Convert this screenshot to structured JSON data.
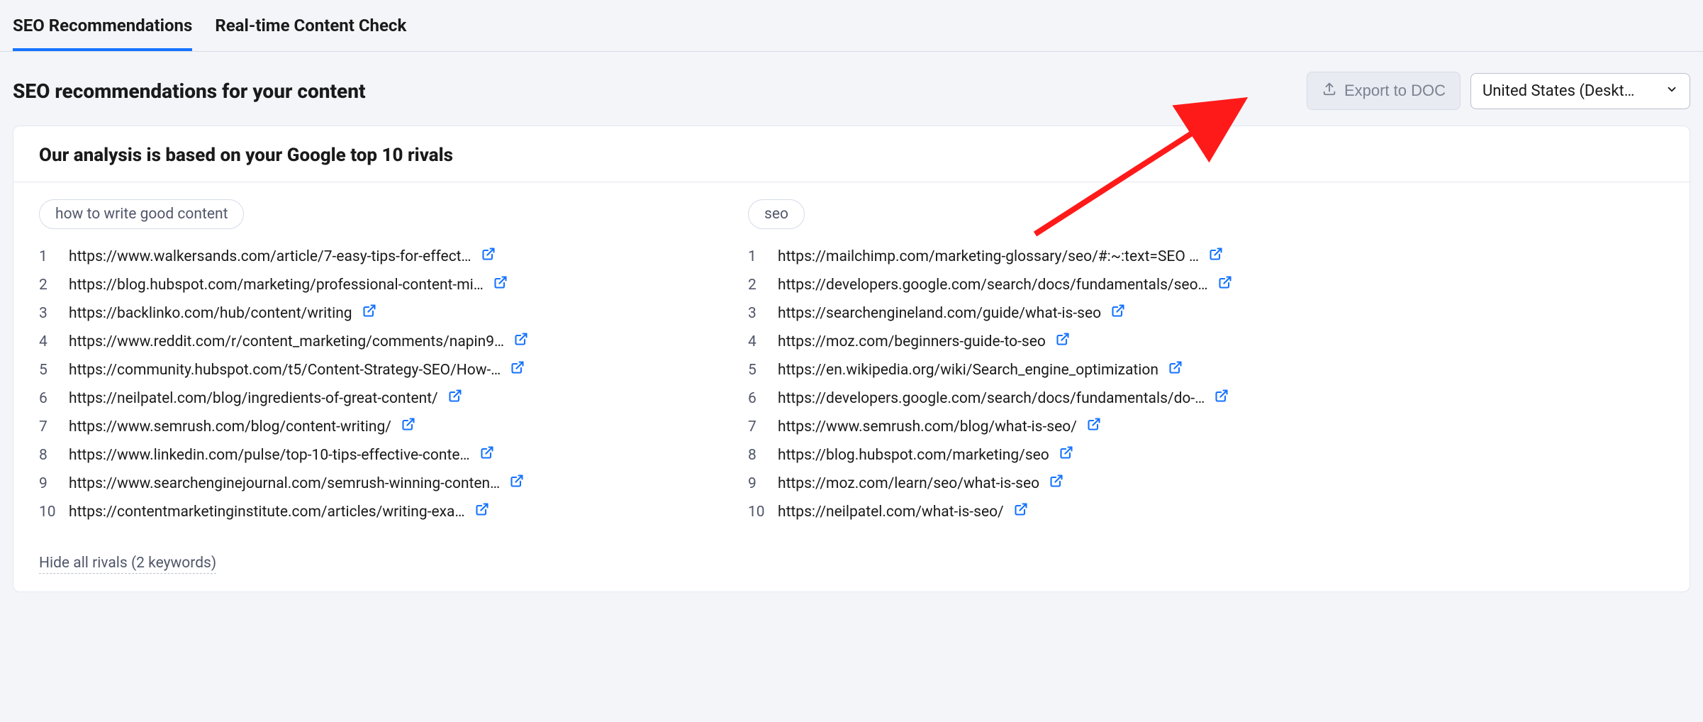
{
  "tabs": [
    {
      "label": "SEO Recommendations",
      "active": true
    },
    {
      "label": "Real-time Content Check",
      "active": false
    }
  ],
  "header": {
    "title": "SEO recommendations for your content",
    "export_label": "Export to DOC",
    "location_label": "United States (Deskt…"
  },
  "analysis": {
    "title": "Our analysis is based on your Google top 10 rivals",
    "columns": [
      {
        "keyword": "how to write good content",
        "rivals": [
          "https://www.walkersands.com/article/7-easy-tips-for-effect…",
          "https://blog.hubspot.com/marketing/professional-content-mi…",
          "https://backlinko.com/hub/content/writing",
          "https://www.reddit.com/r/content_marketing/comments/napin9…",
          "https://community.hubspot.com/t5/Content-Strategy-SEO/How-…",
          "https://neilpatel.com/blog/ingredients-of-great-content/",
          "https://www.semrush.com/blog/content-writing/",
          "https://www.linkedin.com/pulse/top-10-tips-effective-conte…",
          "https://www.searchenginejournal.com/semrush-winning-conten…",
          "https://contentmarketinginstitute.com/articles/writing-exa…"
        ]
      },
      {
        "keyword": "seo",
        "rivals": [
          "https://mailchimp.com/marketing-glossary/seo/#:~:text=SEO …",
          "https://developers.google.com/search/docs/fundamentals/seo…",
          "https://searchengineland.com/guide/what-is-seo",
          "https://moz.com/beginners-guide-to-seo",
          "https://en.wikipedia.org/wiki/Search_engine_optimization",
          "https://developers.google.com/search/docs/fundamentals/do-…",
          "https://www.semrush.com/blog/what-is-seo/",
          "https://blog.hubspot.com/marketing/seo",
          "https://moz.com/learn/seo/what-is-seo",
          "https://neilpatel.com/what-is-seo/"
        ]
      }
    ],
    "hide_link": "Hide all rivals (2 keywords)"
  }
}
